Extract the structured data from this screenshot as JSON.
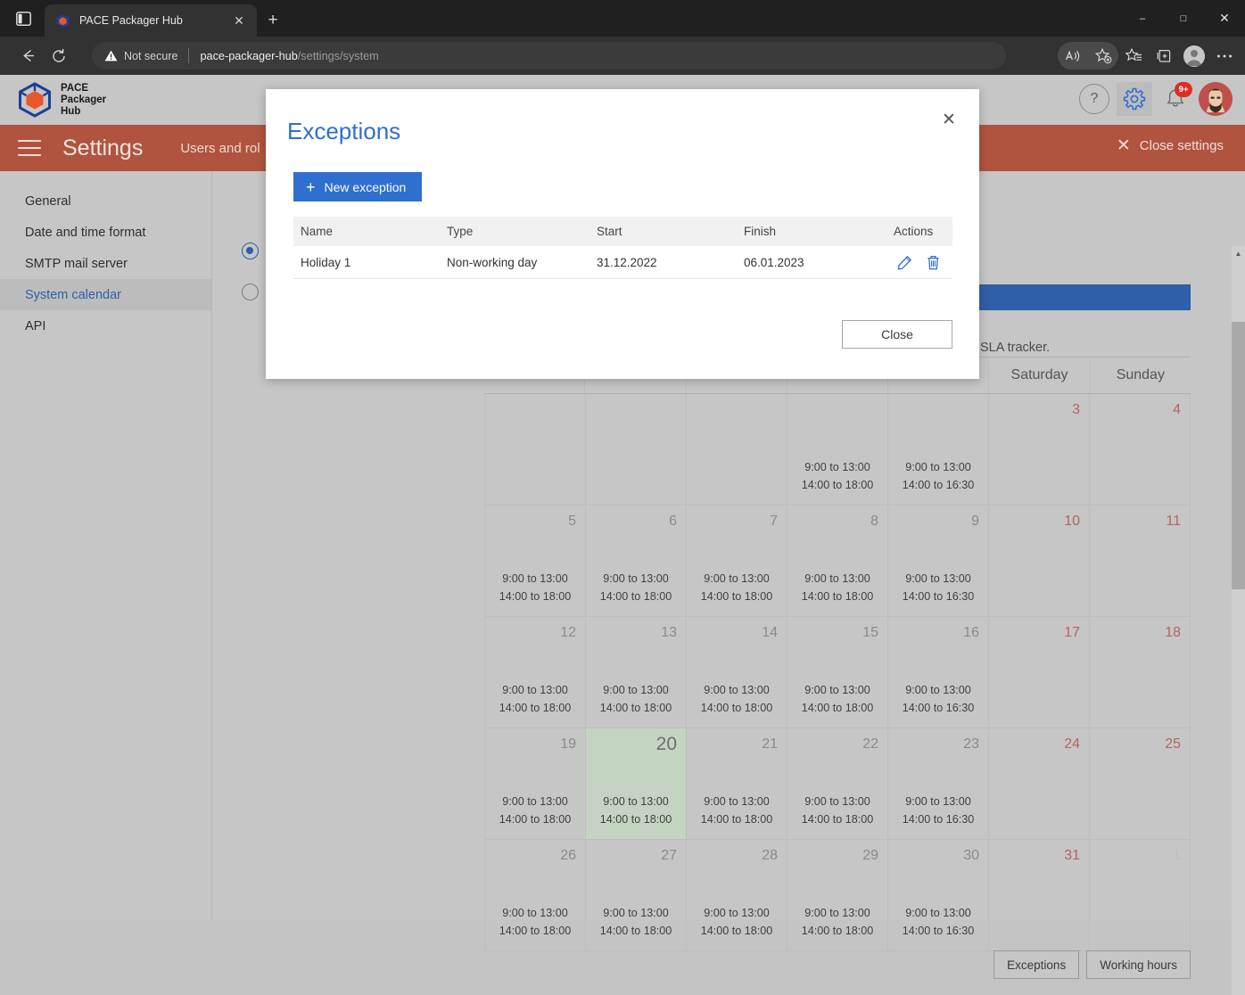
{
  "browser": {
    "tab": {
      "title": "PACE Packager Hub",
      "favicon_icon": "pace-cube-icon",
      "close_icon": "close-icon"
    },
    "new_tab_label": "+",
    "sidebar_toggle_icon": "tab-sidebar-icon",
    "nav": {
      "back_icon": "back-arrow-icon",
      "reload_icon": "reload-icon"
    },
    "security": {
      "label": "Not secure",
      "icon": "warning-triangle-icon"
    },
    "url": {
      "host": "pace-packager-hub",
      "path": "/settings/system"
    },
    "toolbar_icons": [
      "read-aloud-icon",
      "add-favorite-icon",
      "favorites-icon",
      "collections-icon",
      "profile-icon",
      "more-icon"
    ],
    "window_controls": {
      "minimize": "–",
      "maximize": "□",
      "close": "✕"
    }
  },
  "app": {
    "brand": {
      "line1": "PACE",
      "line2": "Packager",
      "line3": "Hub",
      "logo_icon": "pace-cube-logo"
    },
    "topbar_icons": {
      "help": "?",
      "help_name": "help-icon",
      "gear_name": "gear-icon",
      "bell_name": "bell-icon",
      "notification_badge": "9+",
      "avatar_name": "user-avatar"
    },
    "settings_header": {
      "title": "Settings",
      "nav_label": "Users and rol",
      "close_label": "Close settings",
      "close_icon": "close-icon",
      "menu_icon": "hamburger-icon",
      "accent": "#b0543f"
    },
    "sidebar": {
      "items": [
        {
          "label": "General",
          "active": false
        },
        {
          "label": "Date and time format",
          "active": false
        },
        {
          "label": "SMTP mail server",
          "active": false
        },
        {
          "label": "System calendar",
          "active": true
        },
        {
          "label": "API",
          "active": false
        }
      ]
    },
    "content": {
      "sla_text": "SLA tracker.",
      "accent_blue": "#2f5fa8"
    }
  },
  "calendar": {
    "weekday_headers": [
      "",
      "",
      "",
      "",
      "",
      "Saturday",
      "Sunday"
    ],
    "today": 20,
    "today_highlight_color": "#c3d5c0",
    "hours_weekday": "9:00 to 13:00\n14:00 to 18:00",
    "hours_friday": "9:00 to 13:00\n14:00 to 16:30",
    "rows": [
      [
        {
          "day": "",
          "hours": "",
          "weekend": false
        },
        {
          "day": "",
          "hours": "",
          "weekend": false
        },
        {
          "day": "",
          "hours": "",
          "weekend": false
        },
        {
          "day": "",
          "hours": "9:00 to 13:00|14:00 to 18:00",
          "weekend": false
        },
        {
          "day": "",
          "hours": "9:00 to 13:00|14:00 to 16:30",
          "weekend": false
        },
        {
          "day": "3",
          "hours": "",
          "weekend": true
        },
        {
          "day": "4",
          "hours": "",
          "weekend": true
        }
      ],
      [
        {
          "day": "5",
          "hours": "9:00 to 13:00|14:00 to 18:00",
          "weekend": false
        },
        {
          "day": "6",
          "hours": "9:00 to 13:00|14:00 to 18:00",
          "weekend": false
        },
        {
          "day": "7",
          "hours": "9:00 to 13:00|14:00 to 18:00",
          "weekend": false
        },
        {
          "day": "8",
          "hours": "9:00 to 13:00|14:00 to 18:00",
          "weekend": false
        },
        {
          "day": "9",
          "hours": "9:00 to 13:00|14:00 to 16:30",
          "weekend": false
        },
        {
          "day": "10",
          "hours": "",
          "weekend": true
        },
        {
          "day": "11",
          "hours": "",
          "weekend": true
        }
      ],
      [
        {
          "day": "12",
          "hours": "9:00 to 13:00|14:00 to 18:00",
          "weekend": false
        },
        {
          "day": "13",
          "hours": "9:00 to 13:00|14:00 to 18:00",
          "weekend": false
        },
        {
          "day": "14",
          "hours": "9:00 to 13:00|14:00 to 18:00",
          "weekend": false
        },
        {
          "day": "15",
          "hours": "9:00 to 13:00|14:00 to 18:00",
          "weekend": false
        },
        {
          "day": "16",
          "hours": "9:00 to 13:00|14:00 to 16:30",
          "weekend": false
        },
        {
          "day": "17",
          "hours": "",
          "weekend": true
        },
        {
          "day": "18",
          "hours": "",
          "weekend": true
        }
      ],
      [
        {
          "day": "19",
          "hours": "9:00 to 13:00|14:00 to 18:00",
          "weekend": false
        },
        {
          "day": "20",
          "hours": "9:00 to 13:00|14:00 to 18:00",
          "weekend": false,
          "today": true
        },
        {
          "day": "21",
          "hours": "9:00 to 13:00|14:00 to 18:00",
          "weekend": false
        },
        {
          "day": "22",
          "hours": "9:00 to 13:00|14:00 to 18:00",
          "weekend": false
        },
        {
          "day": "23",
          "hours": "9:00 to 13:00|14:00 to 16:30",
          "weekend": false
        },
        {
          "day": "24",
          "hours": "",
          "weekend": true
        },
        {
          "day": "25",
          "hours": "",
          "weekend": true
        }
      ],
      [
        {
          "day": "26",
          "hours": "9:00 to 13:00|14:00 to 18:00",
          "weekend": false
        },
        {
          "day": "27",
          "hours": "9:00 to 13:00|14:00 to 18:00",
          "weekend": false
        },
        {
          "day": "28",
          "hours": "9:00 to 13:00|14:00 to 18:00",
          "weekend": false
        },
        {
          "day": "29",
          "hours": "9:00 to 13:00|14:00 to 18:00",
          "weekend": false
        },
        {
          "day": "30",
          "hours": "9:00 to 13:00|14:00 to 16:30",
          "weekend": false
        },
        {
          "day": "31",
          "hours": "",
          "weekend": true
        },
        {
          "day": "1",
          "hours": "",
          "weekend": false,
          "muted": true
        }
      ]
    ],
    "footer_buttons": [
      {
        "label": "Exceptions"
      },
      {
        "label": "Working hours"
      }
    ]
  },
  "modal": {
    "title": "Exceptions",
    "close_icon": "close-icon",
    "new_exception_label": "New exception",
    "new_exception_plus": "+",
    "columns": [
      "Name",
      "Type",
      "Start",
      "Finish",
      "Actions"
    ],
    "rows": [
      {
        "name": "Holiday 1",
        "type": "Non-working day",
        "start": "31.12.2022",
        "finish": "06.01.2023",
        "edit_icon": "pencil-icon",
        "delete_icon": "trash-icon"
      }
    ],
    "close_button_label": "Close",
    "accent": "#2f6fd0"
  }
}
